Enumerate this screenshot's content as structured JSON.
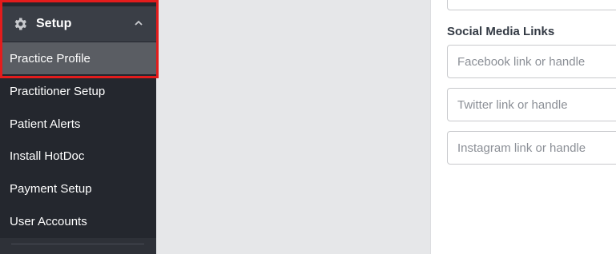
{
  "sidebar": {
    "header": {
      "label": "Setup",
      "icon": "gear-icon",
      "chevron": "chevron-up-icon"
    },
    "items": [
      {
        "label": "Practice Profile",
        "active": true
      },
      {
        "label": "Practitioner Setup"
      },
      {
        "label": "Patient Alerts"
      },
      {
        "label": "Install HotDoc"
      },
      {
        "label": "Payment Setup"
      },
      {
        "label": "User Accounts"
      }
    ]
  },
  "social": {
    "title": "Social Media Links",
    "facebook_placeholder": "Facebook link or handle",
    "twitter_placeholder": "Twitter link or handle",
    "instagram_placeholder": "Instagram link or handle"
  },
  "colors": {
    "sidebar_bg": "#24272e",
    "active_bg": "#5a5d63",
    "highlight": "#e31c1c"
  }
}
